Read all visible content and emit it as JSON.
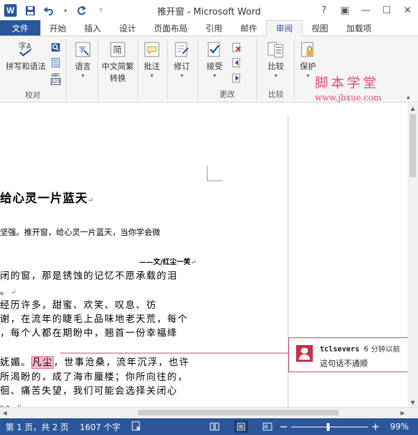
{
  "titlebar": {
    "app_icon": "W",
    "title": "推开窗 - Microsoft Word",
    "qat": [
      "save-icon",
      "undo-icon",
      "redo-icon",
      "customize-icon"
    ],
    "help": "?",
    "restore": "▣",
    "minimize": "—",
    "maximize": "☐",
    "close": "✕"
  },
  "tabs": [
    "文件",
    "开始",
    "插入",
    "设计",
    "页面布局",
    "引用",
    "邮件",
    "审阅",
    "视图",
    "加载项"
  ],
  "ribbon": {
    "proofing": {
      "spelling": "拼写和语法",
      "abc": "ABC",
      "abc_num": "123",
      "label": "校对"
    },
    "language": "语言",
    "chinese": [
      "中文简繁",
      "转换"
    ],
    "comment": "批注",
    "tracking": "修订",
    "accept": "接受",
    "changes_label": "更改",
    "compare": "比较",
    "compare_label": "比较",
    "protect": "保护"
  },
  "watermark": {
    "cn": "脚本学堂",
    "url": "www.jbxue.com"
  },
  "doc": {
    "heading": "给心灵一片蓝天",
    "line1": "坚强。推开窗，给心灵一片蓝天，当你学会微",
    "author": "——文/红尘一笑",
    "line2": "闭的窗，那是锈蚀的记忆不愿承载的泪",
    "line3": "。",
    "line4": "经历许多，甜蜜、欢笑、叹息、彷",
    "line5": "谢，在流年的睫毛上品味地老天荒，每个",
    "line6": "，每个人都在期盼中，翘首一份幸福绛",
    "line7_pre": "妩媚。",
    "line7_hl": "凡尘",
    "line7_post": "，世事沧桑，流年沉浮，也许",
    "line8": "所渴盼的，成了海市蜃楼；你所向往的，",
    "line9": "徊、痛苦失望，我们可能会选择关闭心",
    "line10": "。。"
  },
  "comment": {
    "author": "tclsevers",
    "time": "6 分钟以前",
    "text": "这句话不通顺"
  },
  "status": {
    "page": "第 1 页，共 2 页",
    "words": "1607 个字",
    "zoom_pct": "99%",
    "zoom_level": 0.48
  }
}
